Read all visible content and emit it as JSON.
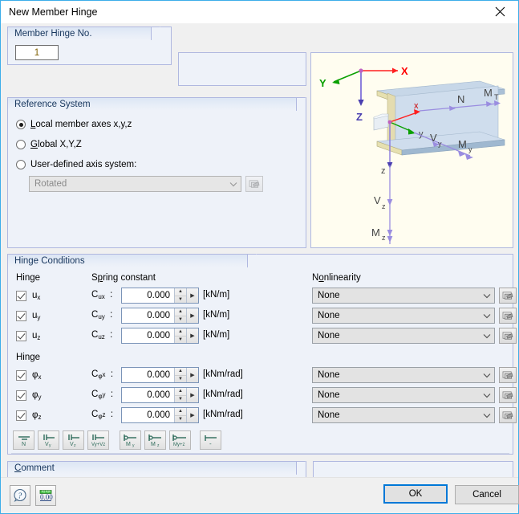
{
  "window": {
    "title": "New Member Hinge",
    "close_icon": "close-icon"
  },
  "hinge_no": {
    "legend": "Member Hinge No.",
    "value": "1"
  },
  "reference_system": {
    "legend": "Reference System",
    "options": [
      {
        "label": "Local member axes x,y,z",
        "selected": true
      },
      {
        "label": "Global X,Y,Z",
        "selected": false
      },
      {
        "label": "User-defined axis system:",
        "selected": false
      }
    ],
    "axis_system_value": "Rotated",
    "axis_system_button_icon": "edit-axis-system-icon"
  },
  "graphic": {
    "global_axes": [
      "X",
      "Y",
      "Z"
    ],
    "local_axes": [
      "x",
      "y",
      "z"
    ],
    "force_labels": [
      "N",
      "M_T",
      "V_y",
      "M_y",
      "V_z",
      "M_z"
    ]
  },
  "hinge_conditions": {
    "legend": "Hinge Conditions",
    "col_hinge": "Hinge",
    "col_spring": "Spring constant",
    "col_nonlinearity": "Nonlinearity",
    "col_hinge2": "Hinge",
    "translational": [
      {
        "name": "u",
        "sub": "x",
        "checked": true,
        "const_name": "C",
        "const_sub": "ux",
        "value": "0.000",
        "unit": "[kN/m]",
        "nonlinearity": "None"
      },
      {
        "name": "u",
        "sub": "y",
        "checked": true,
        "const_name": "C",
        "const_sub": "uy",
        "value": "0.000",
        "unit": "[kN/m]",
        "nonlinearity": "None"
      },
      {
        "name": "u",
        "sub": "z",
        "checked": true,
        "const_name": "C",
        "const_sub": "uz",
        "value": "0.000",
        "unit": "[kN/m]",
        "nonlinearity": "None"
      }
    ],
    "rotational": [
      {
        "name": "φ",
        "sub": "x",
        "checked": true,
        "const_name": "C",
        "const_sub": "φx",
        "value": "0.000",
        "unit": "[kNm/rad]",
        "nonlinearity": "None"
      },
      {
        "name": "φ",
        "sub": "y",
        "checked": true,
        "const_name": "C",
        "const_sub": "φy",
        "value": "0.000",
        "unit": "[kNm/rad]",
        "nonlinearity": "None"
      },
      {
        "name": "φ",
        "sub": "z",
        "checked": true,
        "const_name": "C",
        "const_sub": "φz",
        "value": "0.000",
        "unit": "[kNm/rad]",
        "nonlinearity": "None"
      }
    ],
    "colon": ":",
    "quick_buttons": [
      {
        "icon": "release-N-icon",
        "label": "N"
      },
      {
        "icon": "release-Vy-icon",
        "label": "Vy"
      },
      {
        "icon": "release-Vz-icon",
        "label": "Vz"
      },
      {
        "icon": "release-Vy-Vz-icon",
        "label": "Vy+Vz"
      },
      {
        "icon": "release-My-icon",
        "label": "My"
      },
      {
        "icon": "release-Mz-icon",
        "label": "Mz"
      },
      {
        "icon": "release-My-Mz-icon",
        "label": "My+z"
      },
      {
        "icon": "release-full-icon",
        "label": "-"
      }
    ]
  },
  "comment": {
    "legend": "Comment",
    "value": "",
    "button_icon": "comment-library-icon"
  },
  "footer": {
    "help_icon": "help-icon",
    "units_icon": "units-and-decimal-places-icon",
    "ok_label": "OK",
    "cancel_label": "Cancel"
  },
  "colors": {
    "accent": "#0078d7",
    "title_border": "#3daee9",
    "group_border": "#b0b8e0",
    "group_bg": "#eef2f9",
    "header_text": "#17365d",
    "value_text": "#806000",
    "graphic_bg": "#fffdf0",
    "axis_x": "#ff0000",
    "axis_y": "#00a000",
    "axis_z": "#6a5acd",
    "beam": "#a8bfd6"
  }
}
